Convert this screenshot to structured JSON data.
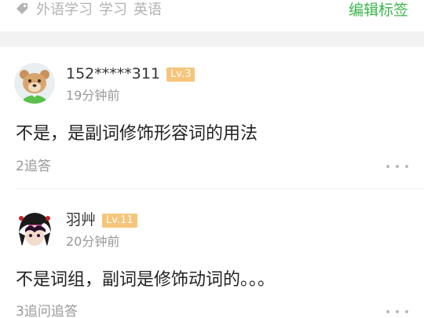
{
  "tag_bar": {
    "tags": [
      "外语学习",
      "学习",
      "英语"
    ],
    "edit_label": "编辑标签",
    "accent_color": "#3bb54a"
  },
  "answers": [
    {
      "username": "152*****311",
      "level": "Lv.3",
      "time": "19分钟前",
      "content": "不是，是副词修饰形容词的用法",
      "reply": "2追答",
      "avatar_icon": "bear-avatar-icon"
    },
    {
      "username": "羽艸",
      "level": "Lv.11",
      "time": "20分钟前",
      "content": "不是词组，副词是修饰动词的。。。",
      "reply": "3追问追答",
      "avatar_icon": "anime-avatar-icon"
    }
  ]
}
